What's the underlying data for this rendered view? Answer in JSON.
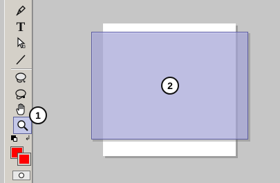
{
  "toolbar": {
    "tools": [
      {
        "name": "pen-tool",
        "icon": "pen-icon"
      },
      {
        "name": "text-tool",
        "icon": "text-icon",
        "glyph": "T"
      },
      {
        "name": "subselect-tool",
        "icon": "subselect-arrow-icon"
      },
      {
        "name": "line-tool",
        "icon": "line-icon"
      },
      {
        "name": "ink-bottle-tool",
        "icon": "ink-bottle-icon"
      },
      {
        "name": "lasso-tool",
        "icon": "lasso-icon"
      },
      {
        "name": "hand-tool",
        "icon": "hand-icon"
      },
      {
        "name": "zoom-tool",
        "icon": "magnifier-icon",
        "active": true
      }
    ],
    "stroke_color": "#ff0000",
    "fill_color": "#ff0000"
  },
  "callouts": {
    "zoom_tool_number": "1",
    "stage_number": "2"
  },
  "colors": {
    "background": "#c6c6c6",
    "stage": "#ffffff",
    "selection_fill": "#b4b4f5",
    "selection_border": "#5b5b9e",
    "active_tool": "#c5c8e8"
  }
}
